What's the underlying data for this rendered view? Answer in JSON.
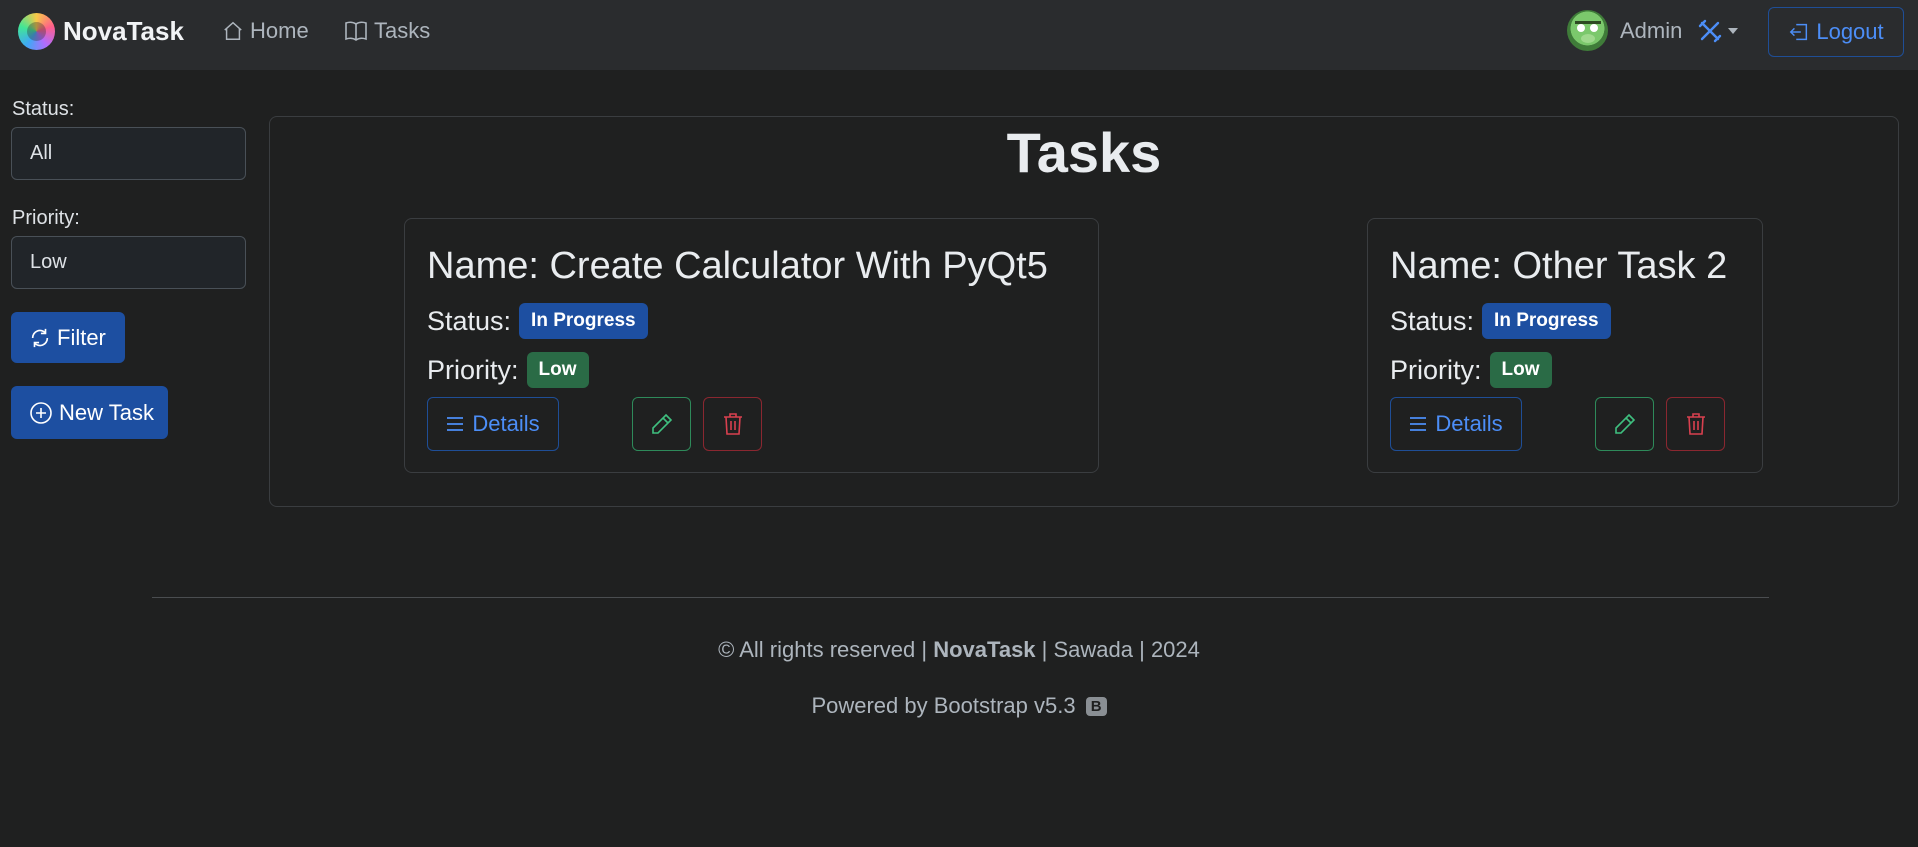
{
  "navbar": {
    "brand": "NovaTask",
    "home_label": "Home",
    "tasks_label": "Tasks",
    "user_name": "Admin",
    "logout_label": "Logout"
  },
  "filters": {
    "status_label": "Status:",
    "status_value": "All",
    "priority_label": "Priority:",
    "priority_value": "Low",
    "filter_button": "Filter",
    "new_task_button": "New Task"
  },
  "main": {
    "title": "Tasks",
    "tasks": [
      {
        "name": "Name: Create Calculator With PyQt5",
        "status_label": "Status:",
        "status": "In Progress",
        "priority_label": "Priority:",
        "priority": "Low",
        "details_label": "Details"
      },
      {
        "name": "Name: Other Task 2",
        "status_label": "Status:",
        "status": "In Progress",
        "priority_label": "Priority:",
        "priority": "Low",
        "details_label": "Details"
      }
    ]
  },
  "footer": {
    "rights_prefix": "© All rights reserved |",
    "brand": "NovaTask",
    "rights_suffix": "| Sawada | 2024",
    "powered": "Powered by Bootstrap v5.3",
    "bootstrap_badge": "B"
  },
  "colors": {
    "background": "#1f2020",
    "navbar": "#2a2c2e",
    "primary": "#1d4fa1",
    "success_badge": "#2a6b46",
    "link_blue": "#4c8ef7"
  }
}
